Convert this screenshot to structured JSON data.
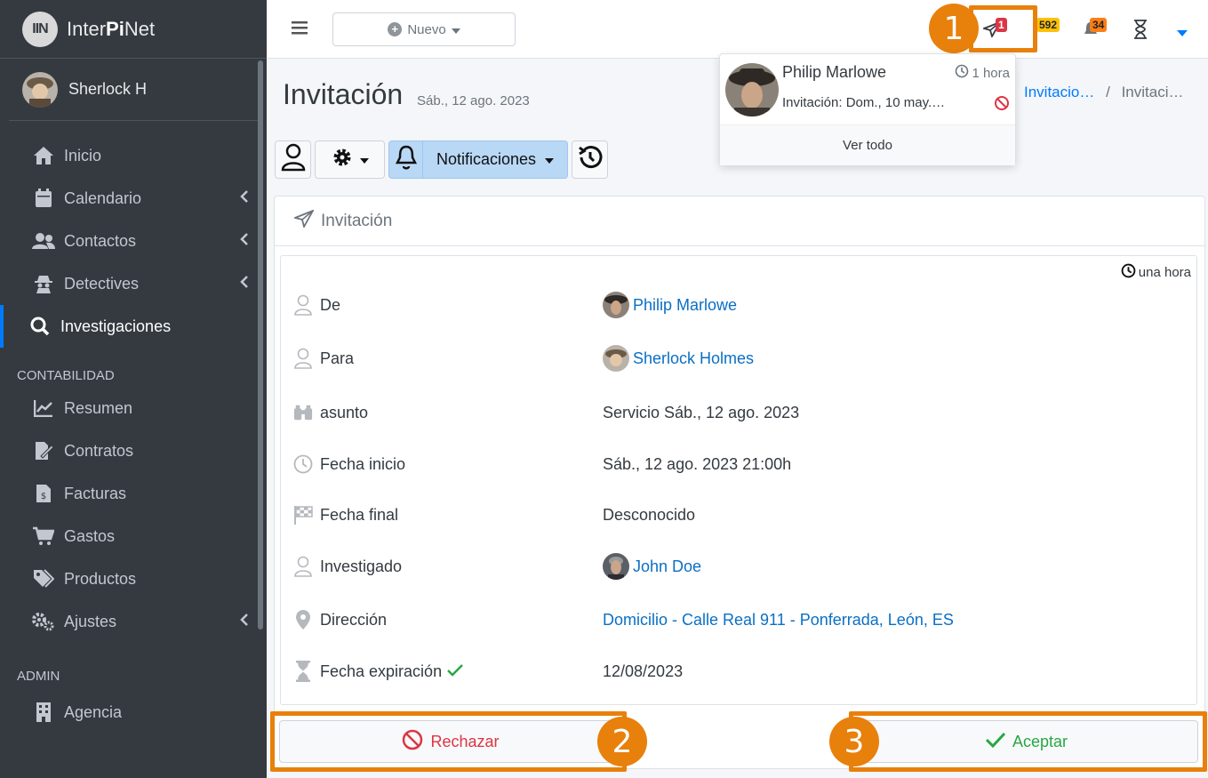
{
  "brand": {
    "logo_text": "IIN",
    "name_prefix": "Inter",
    "name_bold": "Pi",
    "name_suffix": "Net"
  },
  "user": {
    "name": "Sherlock H"
  },
  "sidebar": {
    "items": [
      {
        "label": "Inicio",
        "icon": "home-icon"
      },
      {
        "label": "Calendario",
        "icon": "calendar-icon"
      },
      {
        "label": "Contactos",
        "icon": "users-icon"
      },
      {
        "label": "Detectives",
        "icon": "detective-icon"
      },
      {
        "label": "Investigaciones",
        "icon": "search-icon"
      }
    ],
    "section_contabilidad": "CONTABILIDAD",
    "contabilidad_items": [
      {
        "label": "Resumen",
        "icon": "chart-line-icon"
      },
      {
        "label": "Contratos",
        "icon": "contract-icon"
      },
      {
        "label": "Facturas",
        "icon": "invoice-icon"
      },
      {
        "label": "Gastos",
        "icon": "cart-icon"
      },
      {
        "label": "Productos",
        "icon": "tags-icon"
      },
      {
        "label": "Ajustes",
        "icon": "cogs-icon"
      }
    ],
    "section_admin": "ADMIN",
    "admin_items": [
      {
        "label": "Agencia",
        "icon": "building-icon"
      }
    ]
  },
  "topbar": {
    "nuevo_label": "Nuevo",
    "invitations_badge": "1",
    "messages_badge": "592",
    "alerts_badge": "34"
  },
  "callouts": {
    "one": "1",
    "two": "2",
    "three": "3"
  },
  "dropdown": {
    "name": "Philip Marlowe",
    "time": "1 hora",
    "text": "Invitación: Dom., 10 may.…",
    "footer": "Ver todo"
  },
  "page": {
    "title": "Invitación",
    "subtitle": "Sáb., 12 ago. 2023",
    "breadcrumb_1": "Invitacio…",
    "breadcrumb_sep": "/",
    "breadcrumb_2": "Invitaci…"
  },
  "toolbar": {
    "notificaciones_label": "Notificaciones"
  },
  "card": {
    "title": "Invitación",
    "relative_time": "una hora",
    "rows": [
      {
        "label": "De",
        "value": "Philip Marlowe"
      },
      {
        "label": "Para",
        "value": "Sherlock Holmes"
      },
      {
        "label": "asunto",
        "value": "Servicio Sáb., 12 ago. 2023"
      },
      {
        "label": "Fecha inicio",
        "value": "Sáb., 12 ago. 2023 21:00h"
      },
      {
        "label": "Fecha final",
        "value": "Desconocido"
      },
      {
        "label": "Investigado",
        "value": "John Doe"
      },
      {
        "label": "Dirección",
        "value": "Domicilio - Calle Real 911 - Ponferrada, León, ES"
      },
      {
        "label": "Fecha expiración",
        "value": "12/08/2023"
      }
    ]
  },
  "actions": {
    "reject_label": "Rechazar",
    "accept_label": "Aceptar"
  },
  "colors": {
    "sidebar_bg": "#343a40",
    "accent": "#007bff",
    "callout": "#e8800c",
    "danger": "#dc3545",
    "success": "#28a745",
    "link": "#0b6fc4"
  }
}
